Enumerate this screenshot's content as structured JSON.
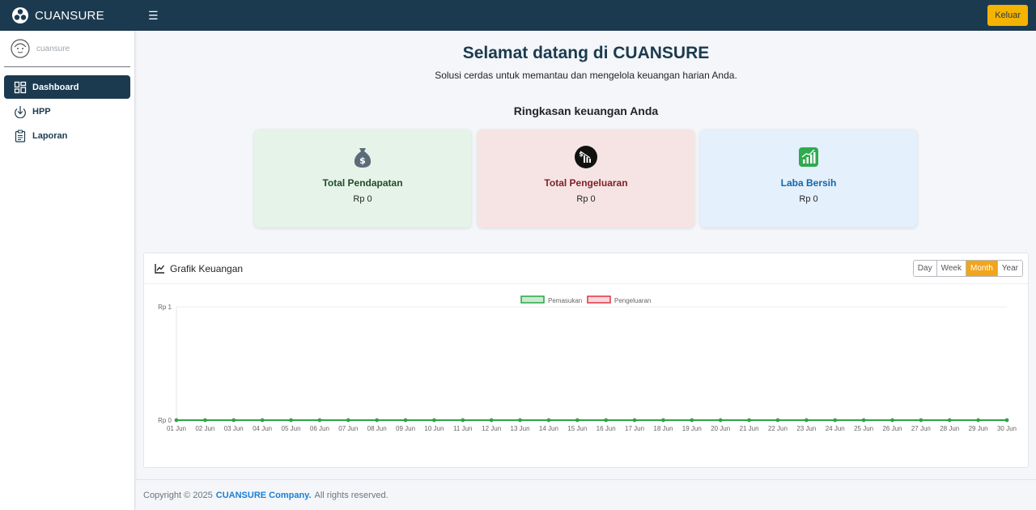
{
  "navbar": {
    "brand": "CUANSURE",
    "menu_icon": "bars-icon",
    "logout_label": "Keluar"
  },
  "sidebar": {
    "user_name": "cuansure",
    "items": [
      {
        "label": "Dashboard",
        "icon": "dashboard-grid-icon",
        "active": true
      },
      {
        "label": "HPP",
        "icon": "download-circle-icon",
        "active": false
      },
      {
        "label": "Laporan",
        "icon": "clipboard-icon",
        "active": false
      }
    ]
  },
  "main": {
    "title": "Selamat datang di CUANSURE",
    "subtitle": "Solusi cerdas untuk memantau dan mengelola keuangan harian Anda.",
    "summary_title": "Ringkasan keuangan Anda",
    "cards": [
      {
        "title": "Total Pendapatan",
        "value": "Rp 0",
        "icon": "money-bag-icon",
        "color": "#e6f3e8"
      },
      {
        "title": "Total Pengeluaran",
        "value": "Rp 0",
        "icon": "expense-chart-icon",
        "color": "#f6e4e4"
      },
      {
        "title": "Laba Bersih",
        "value": "Rp 0",
        "icon": "growth-chart-icon",
        "color": "#e4f0fb"
      }
    ]
  },
  "chart_panel": {
    "title": "Grafik Keuangan",
    "icon": "line-chart-icon",
    "ranges": [
      "Day",
      "Week",
      "Month",
      "Year"
    ],
    "active_range": "Month"
  },
  "chart_data": {
    "type": "line",
    "x": [
      "01 Jun",
      "02 Jun",
      "03 Jun",
      "04 Jun",
      "05 Jun",
      "06 Jun",
      "07 Jun",
      "08 Jun",
      "09 Jun",
      "10 Jun",
      "11 Jun",
      "12 Jun",
      "13 Jun",
      "14 Jun",
      "15 Jun",
      "16 Jun",
      "17 Jun",
      "18 Jun",
      "19 Jun",
      "20 Jun",
      "21 Jun",
      "22 Jun",
      "23 Jun",
      "24 Jun",
      "25 Jun",
      "26 Jun",
      "27 Jun",
      "28 Jun",
      "29 Jun",
      "30 Jun"
    ],
    "series": [
      {
        "name": "Pemasukan",
        "color": "#28a745",
        "values": [
          0,
          0,
          0,
          0,
          0,
          0,
          0,
          0,
          0,
          0,
          0,
          0,
          0,
          0,
          0,
          0,
          0,
          0,
          0,
          0,
          0,
          0,
          0,
          0,
          0,
          0,
          0,
          0,
          0,
          0
        ]
      },
      {
        "name": "Pengeluaran",
        "color": "#dc3545",
        "values": [
          0,
          0,
          0,
          0,
          0,
          0,
          0,
          0,
          0,
          0,
          0,
          0,
          0,
          0,
          0,
          0,
          0,
          0,
          0,
          0,
          0,
          0,
          0,
          0,
          0,
          0,
          0,
          0,
          0,
          0
        ]
      }
    ],
    "y_ticks": [
      "Rp 0",
      "Rp 1"
    ],
    "ylim": [
      0,
      1
    ],
    "legend": "top-center",
    "grid": false
  },
  "footer": {
    "prefix": "Copyright © 2025",
    "company": "CUANSURE Company.",
    "suffix": "All rights reserved."
  }
}
